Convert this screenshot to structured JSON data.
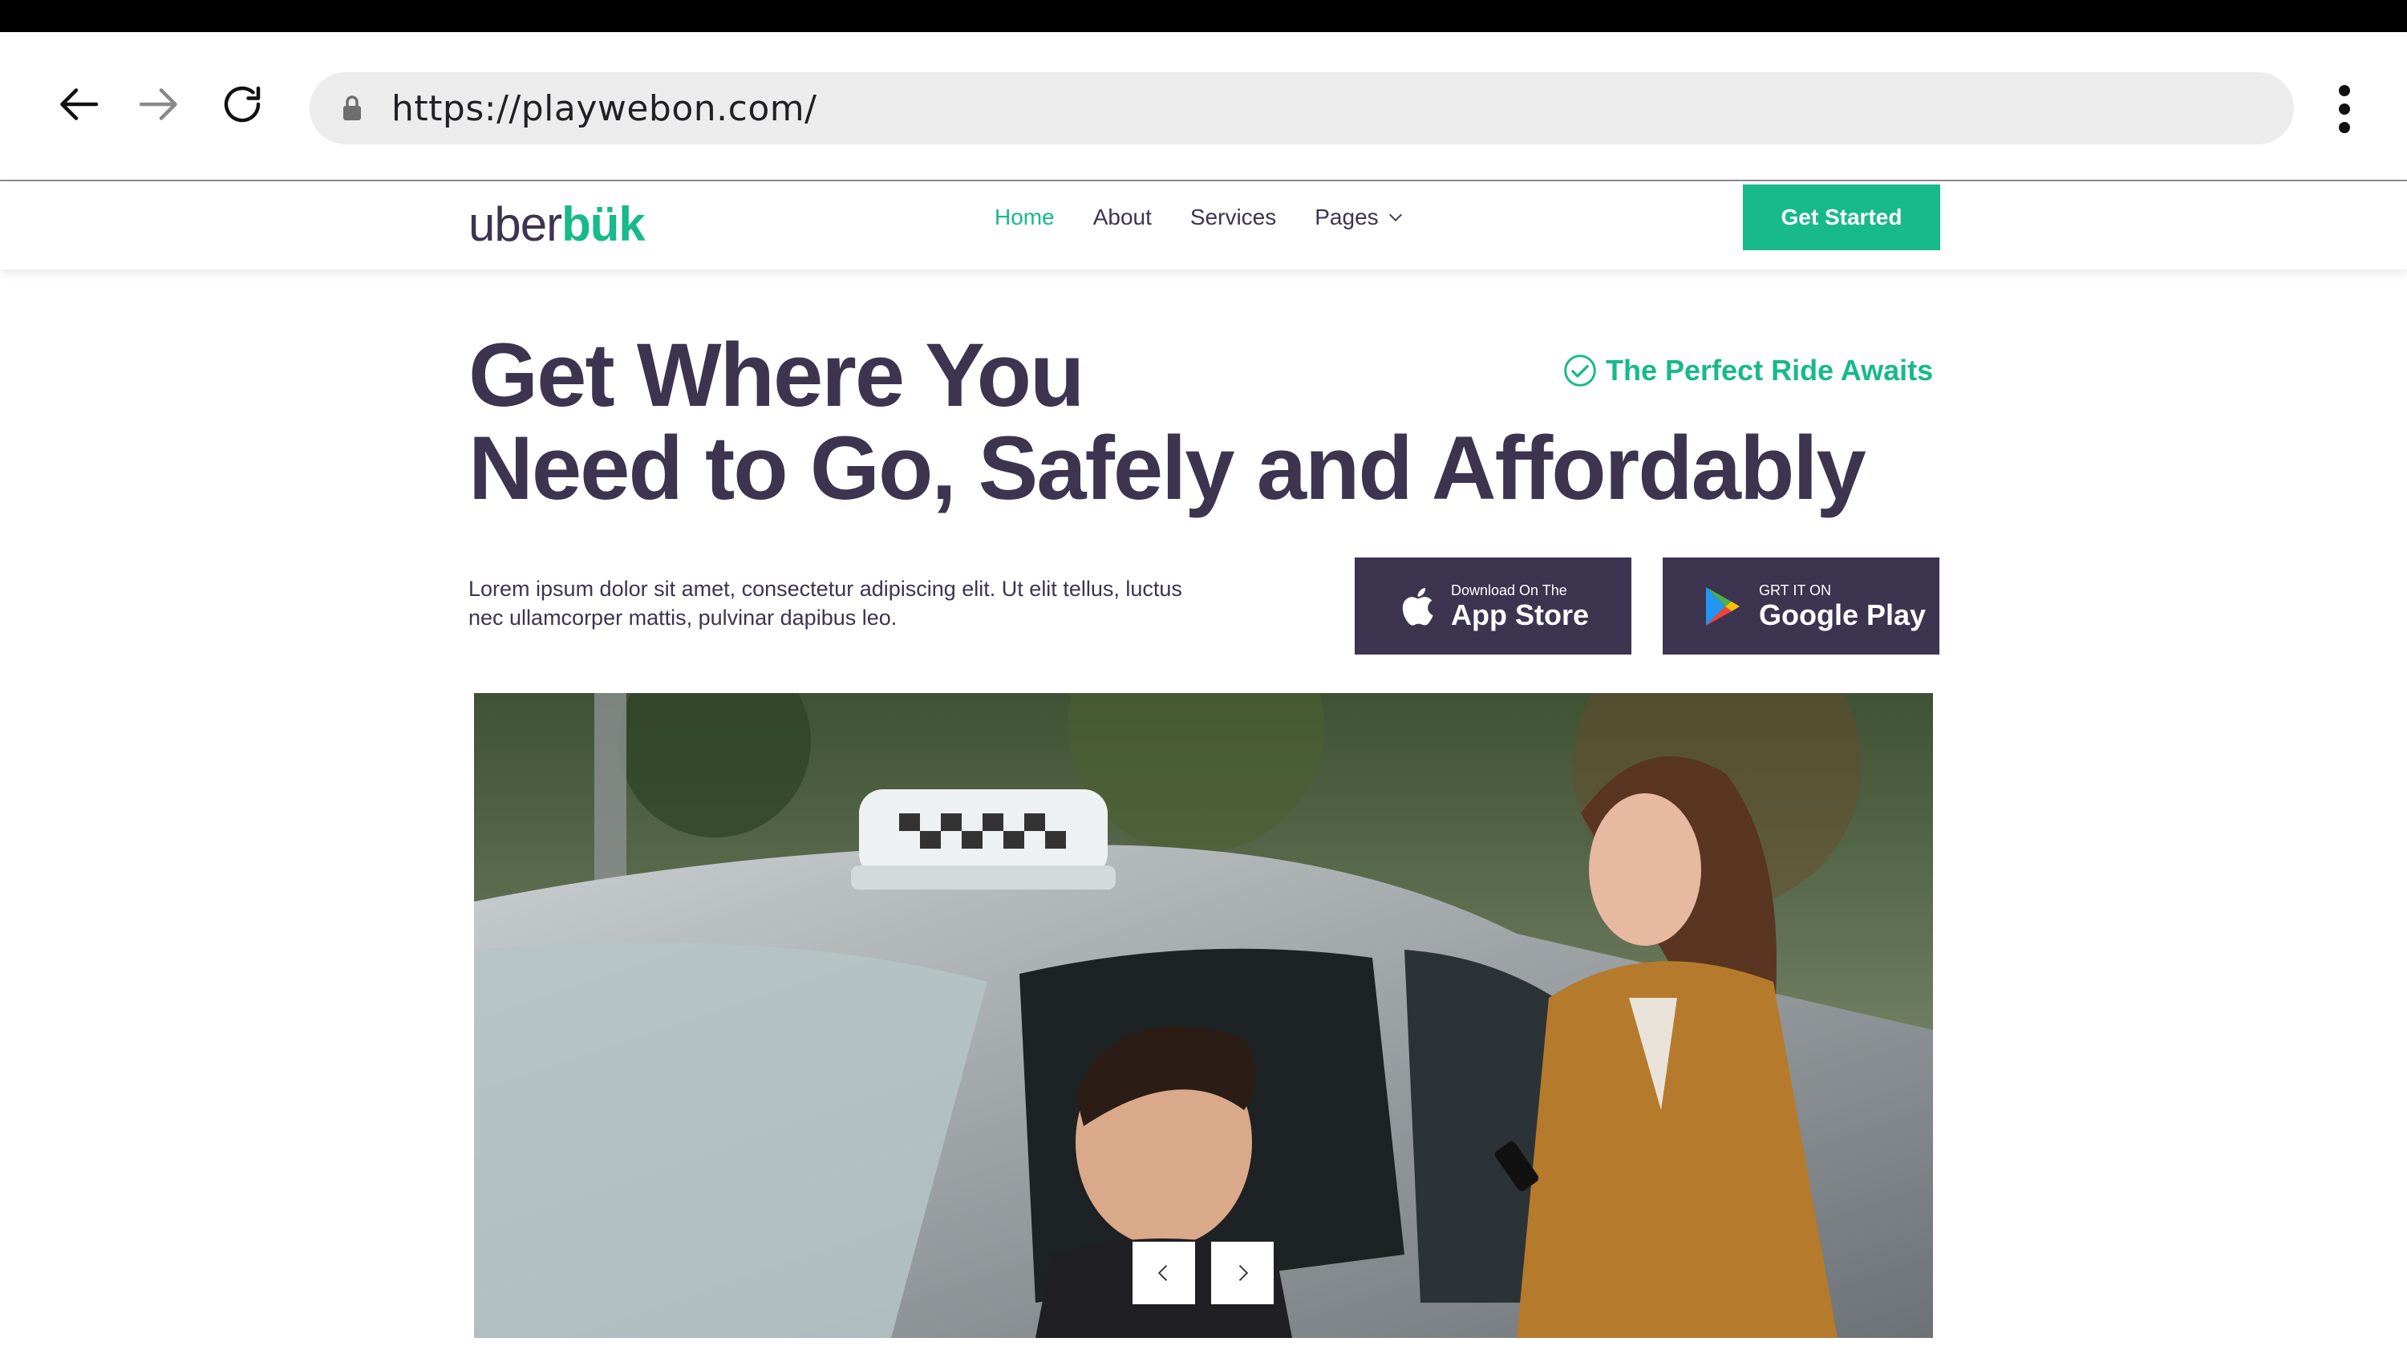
{
  "browser": {
    "url": "https://playwebon.com/",
    "icons": {
      "back": "arrow-left-icon",
      "forward": "arrow-right-icon",
      "reload": "reload-icon",
      "lock": "lock-icon",
      "menu": "more-vertical-icon"
    }
  },
  "header": {
    "logo": {
      "part1": "uber",
      "part2": "bük"
    },
    "nav": [
      {
        "label": "Home",
        "active": true
      },
      {
        "label": "About"
      },
      {
        "label": "Services"
      },
      {
        "label": "Pages",
        "has_dropdown": true
      }
    ],
    "cta": "Get Started"
  },
  "hero": {
    "title_line1": "Get Where You",
    "title_line2": "Need to Go, Safely and Affordably",
    "tagline": "The Perfect Ride Awaits",
    "description": "Lorem ipsum dolor sit amet, consectetur adipiscing elit. Ut elit tellus, luctus nec ullamcorper mattis, pulvinar dapibus leo.",
    "app_store": {
      "small": "Download On The",
      "big": "App Store"
    },
    "google_play": {
      "small": "GRT IT ON",
      "big": "Google Play"
    }
  },
  "colors": {
    "brand_green": "#18b98a",
    "brand_purple": "#3d3450"
  }
}
